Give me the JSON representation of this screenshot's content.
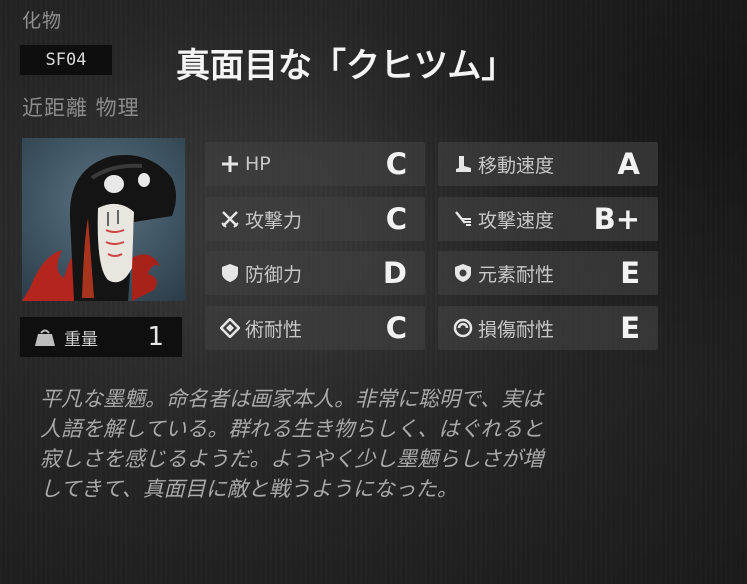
{
  "unit": {
    "category": "化物",
    "code": "SF04",
    "name": "真面目な「クヒツム」",
    "range_type": "近距離 物理",
    "weight_label": "重量",
    "weight_value": "1"
  },
  "stats": [
    {
      "icon": "plus-icon",
      "label": "HP",
      "grade": "C"
    },
    {
      "icon": "boot-icon",
      "label": "移動速度",
      "grade": "A"
    },
    {
      "icon": "crossed-swords-icon",
      "label": "攻撃力",
      "grade": "C"
    },
    {
      "icon": "speed-lines-icon",
      "label": "攻撃速度",
      "grade": "B+"
    },
    {
      "icon": "shield-icon",
      "label": "防御力",
      "grade": "D"
    },
    {
      "icon": "element-shield-icon",
      "label": "元素耐性",
      "grade": "E"
    },
    {
      "icon": "diamond-icon",
      "label": "術耐性",
      "grade": "C"
    },
    {
      "icon": "ring-icon",
      "label": "損傷耐性",
      "grade": "E"
    }
  ],
  "description": [
    "平凡な墨魎。命名者は画家本人。非常に聡明で、実は",
    "人語を解している。群れる生き物らしく、はぐれると",
    "寂しさを感じるようだ。ようやく少し墨魎らしさが増",
    "してきて、真面目に敵と戦うようになった。"
  ]
}
